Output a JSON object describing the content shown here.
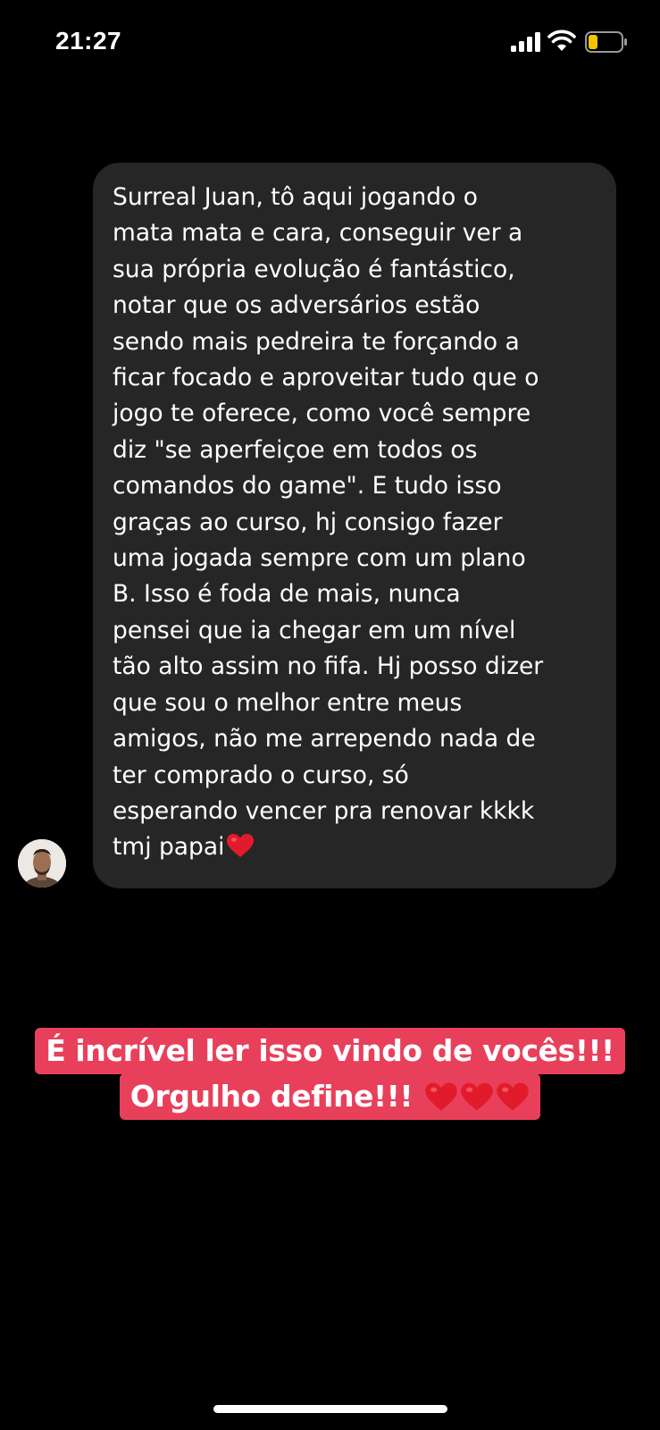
{
  "status_bar": {
    "time": "21:27",
    "icons": [
      "signal-bars-icon",
      "wifi-icon",
      "battery-low-icon"
    ],
    "battery_color": "#f5c400"
  },
  "message": {
    "text": "Surreal Juan, tô aqui jogando o\nmata mata e cara, conseguir ver a\nsua própria evolução é fantástico,\nnotar que os adversários estão\nsendo mais pedreira te forçando a\nficar focado e aproveitar tudo que o\njogo te oferece, como você sempre\ndiz \"se aperfeiçoe em todos os\ncomandos do game\". E tudo isso\ngraças ao curso, hj consigo fazer\numa jogada sempre com um plano\nB. Isso é foda de mais, nunca\npensei que ia chegar em um nível\ntão alto assim no fifa. Hj posso dizer\nque sou o melhor entre meus\namigos, não me arrependo nada de\nter comprado o curso, só\nesperando vencer pra renovar kkkk\ntmj papai",
    "trailing_icon": "red-heart-icon",
    "bubble_color": "#262626",
    "avatar": "sender-avatar"
  },
  "caption": {
    "line1": "É incrível ler isso vindo de vocês!!!",
    "line2": "Orgulho define!!!",
    "trailing_icons": [
      "red-heart-icon",
      "red-heart-icon",
      "red-heart-icon"
    ],
    "background_color": "#e8405b"
  }
}
